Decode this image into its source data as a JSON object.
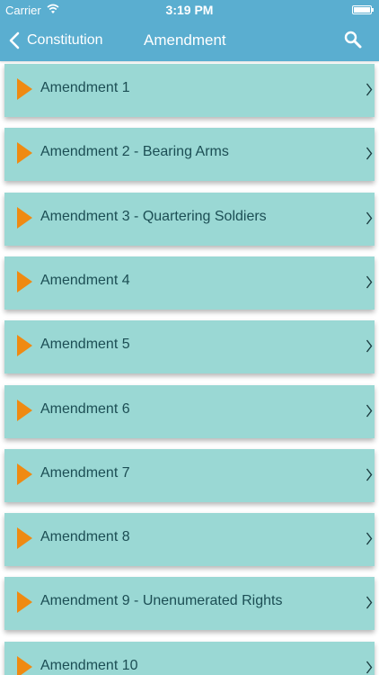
{
  "status_bar": {
    "carrier": "Carrier",
    "time": "3:19 PM",
    "wifi_icon": "wifi-icon",
    "battery_icon": "battery-icon"
  },
  "nav": {
    "back_label": "Constitution",
    "title": "Amendment",
    "search_icon": "search-icon"
  },
  "colors": {
    "header": "#5aaed0",
    "row_background": "#9ad8d4",
    "arrow": "#ef8a12",
    "row_text": "#1c4e54"
  },
  "amendments": [
    {
      "label": "Amendment 1"
    },
    {
      "label": "Amendment 2 - Bearing Arms"
    },
    {
      "label": "Amendment 3 - Quartering Soldiers"
    },
    {
      "label": "Amendment 4"
    },
    {
      "label": "Amendment 5"
    },
    {
      "label": "Amendment 6"
    },
    {
      "label": "Amendment 7"
    },
    {
      "label": "Amendment 8"
    },
    {
      "label": "Amendment 9 - Unenumerated Rights"
    },
    {
      "label": "Amendment 10"
    }
  ]
}
